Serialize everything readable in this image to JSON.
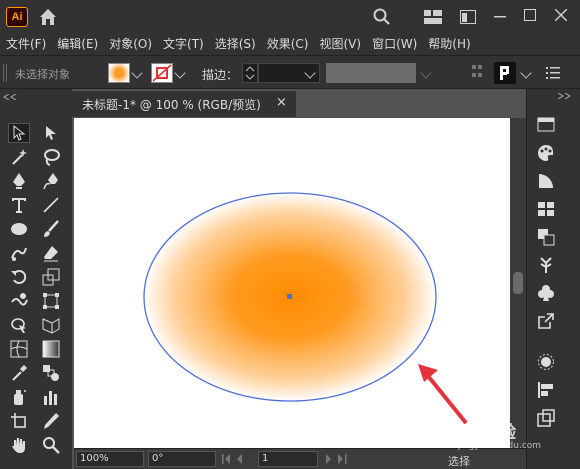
{
  "app": {
    "logo_text": "Ai"
  },
  "menu": [
    "文件(F)",
    "编辑(E)",
    "对象(O)",
    "文字(T)",
    "选择(S)",
    "效果(C)",
    "视图(V)",
    "窗口(W)",
    "帮助(H)"
  ],
  "control_bar": {
    "selection_label": "未选择对象",
    "stroke_label": "描边："
  },
  "tab": {
    "title": "未标题-1* @ 100 % (RGB/预览)",
    "close": "×"
  },
  "status_bar": {
    "zoom": "100%",
    "rotation": "0°",
    "artboard": "1",
    "mode": "选择"
  },
  "watermark": {
    "text": "Bai 经验",
    "sub": "jingyan.baidu.com"
  },
  "colors": {
    "accent": "#ff9a00",
    "ellipse_stroke": "#4f6fd8",
    "fill_center": "#ff9a2a",
    "annotation": "#e5323c"
  }
}
